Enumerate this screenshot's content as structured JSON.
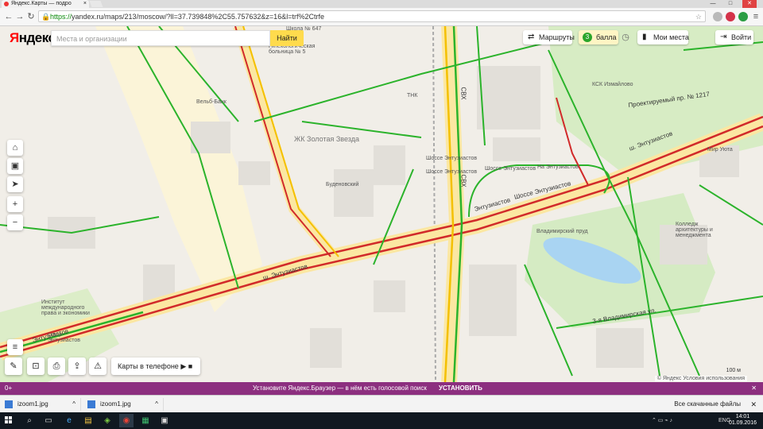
{
  "browser": {
    "tab_title": "Яндекс.Карты — подро",
    "url_secure": "https://",
    "url_rest": "yandex.ru/maps/213/moscow/?ll=37.739848%2C55.757632&z=16&l=trf%2Ctrfe",
    "minimize": "—",
    "maximize": "□",
    "close": "✕"
  },
  "header": {
    "logo_ya": "Я",
    "logo_rest": "ндекс",
    "search_placeholder": "Места и организации",
    "search_button": "Найти",
    "routes": "Маршруты",
    "traffic_score": "3",
    "traffic_label": "балла",
    "my_places": "Мои места",
    "login": "Войти"
  },
  "map_labels": {
    "zk": "ЖК Золотая Звезда",
    "hospital": "Гинекологическая больница № 5",
    "school": "Школа № 647",
    "vel_bank": "Вельб-Банк",
    "budenovsky": "Буденовский",
    "tnk": "ТНК",
    "shosse1": "Шоссе Энтузиастов",
    "shosse2": "Шоссе Энтузиастов",
    "shosse3": "Шоссе Энтузиастов",
    "shosse4": "Шоссе Энтузиастов",
    "na_entuz": "На Энтузиастов",
    "entuz_road": "Шоссе Энтузиастов",
    "entuz_road2": "ш. Энтузиастов",
    "entuz_road3": "Энтузиастов",
    "entuz_road4": "ш. Энтузиастов",
    "entuz_road5": "Энтузиастов",
    "ksk": "КСК Измайлово",
    "mir_uyuta": "Мир Уюта",
    "college": "Колледж архитектуры и менеджмента",
    "pond": "Владимирский пруд",
    "institute": "Институт международного права и экономики",
    "skver": "сквер Энтузиастов",
    "proezd": "Проектируемый пр. № 1217",
    "proezd2": "3-я Владимирская ул.",
    "sv": "СВХ",
    "sv2": "СВХ"
  },
  "controls": {
    "home": "⌂",
    "bag": "▣",
    "locate": "➤",
    "zoom_in": "+",
    "zoom_out": "−",
    "layers": "≡",
    "ruler": "✎",
    "car": "⊡",
    "print": "⎙",
    "share": "⇪",
    "alert": "⚠",
    "phone_text": "Карты в телефоне",
    "phone_icons": "  ▶ ■"
  },
  "footer": {
    "copyright": "© Яндекс  Условия использования",
    "scale": "100 м"
  },
  "promo": {
    "plus": "0+",
    "text": "Установите Яндекс.Браузер — в нём есть голосовой поиск",
    "install": "УСТАНОВИТЬ",
    "close": "✕"
  },
  "downloads": {
    "items": [
      {
        "name": "izoom1.jpg"
      },
      {
        "name": "izoom1.jpg"
      }
    ],
    "all": "Все скачанные файлы",
    "close": "✕"
  },
  "taskbar": {
    "lang": "ENG",
    "time": "14:01",
    "date": "01.09.2016"
  },
  "colors": {
    "traffic_red": "#d12a2a",
    "traffic_yellow": "#f4c000",
    "traffic_green": "#2bb32b",
    "road_yellow": "#fbe7a2",
    "promo": "#8c2f7f",
    "search_button": "#ffdb4d"
  }
}
